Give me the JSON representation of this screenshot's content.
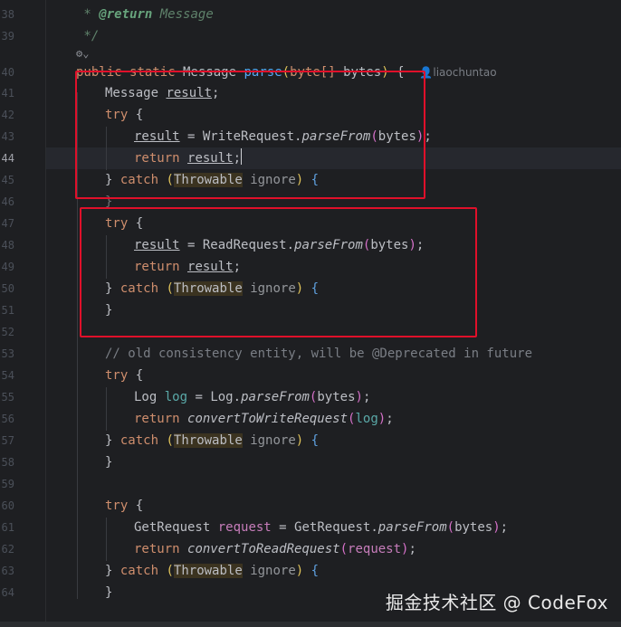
{
  "gutter": {
    "lines": [
      "38",
      "39",
      "",
      "40",
      "41",
      "42",
      "43",
      "44",
      "45",
      "46",
      "47",
      "48",
      "49",
      "50",
      "51",
      "52",
      "53",
      "54",
      "55",
      "56",
      "57",
      "58",
      "59",
      "60",
      "61",
      "62",
      "63",
      "64"
    ],
    "current": "44"
  },
  "code": {
    "l38": {
      "star": " * ",
      "tag": "@return",
      "rest": " Message"
    },
    "l39": " */",
    "l40": {
      "kw1": "public",
      "kw2": "static",
      "type": "Message",
      "fn": "parse",
      "p_open": "(",
      "ptype": "byte[]",
      "param": "bytes",
      "p_close": ")",
      "brace": "{",
      "author": "liaochuntao"
    },
    "l41": {
      "type": "Message",
      "var": "result",
      "end": ";"
    },
    "try": "try",
    "open_brace": "{",
    "close_brace": "}",
    "catch": "catch",
    "throwable": "Throwable",
    "ignore": "ignore",
    "ret": "return",
    "result": "result",
    "bytes": "bytes",
    "l43": {
      "cls": "WriteRequest",
      "method": "parseFrom"
    },
    "l48": {
      "cls": "ReadRequest",
      "method": "parseFrom"
    },
    "l53": "// old consistency entity, will be @Deprecated in future",
    "l55": {
      "type": "Log",
      "var": "log",
      "cls": "Log",
      "method": "parseFrom"
    },
    "l56": {
      "method": "convertToWriteRequest",
      "arg": "log"
    },
    "l61": {
      "type": "GetRequest",
      "var": "request",
      "cls": "GetRequest",
      "method": "parseFrom"
    },
    "l62": {
      "method": "convertToReadRequest",
      "arg": "request"
    }
  },
  "icons": {
    "gear": "gear-chevron-icon",
    "author": "person-icon"
  },
  "highlight_color": "#e0102a",
  "watermark": "掘金技术社区 @ CodeFox"
}
